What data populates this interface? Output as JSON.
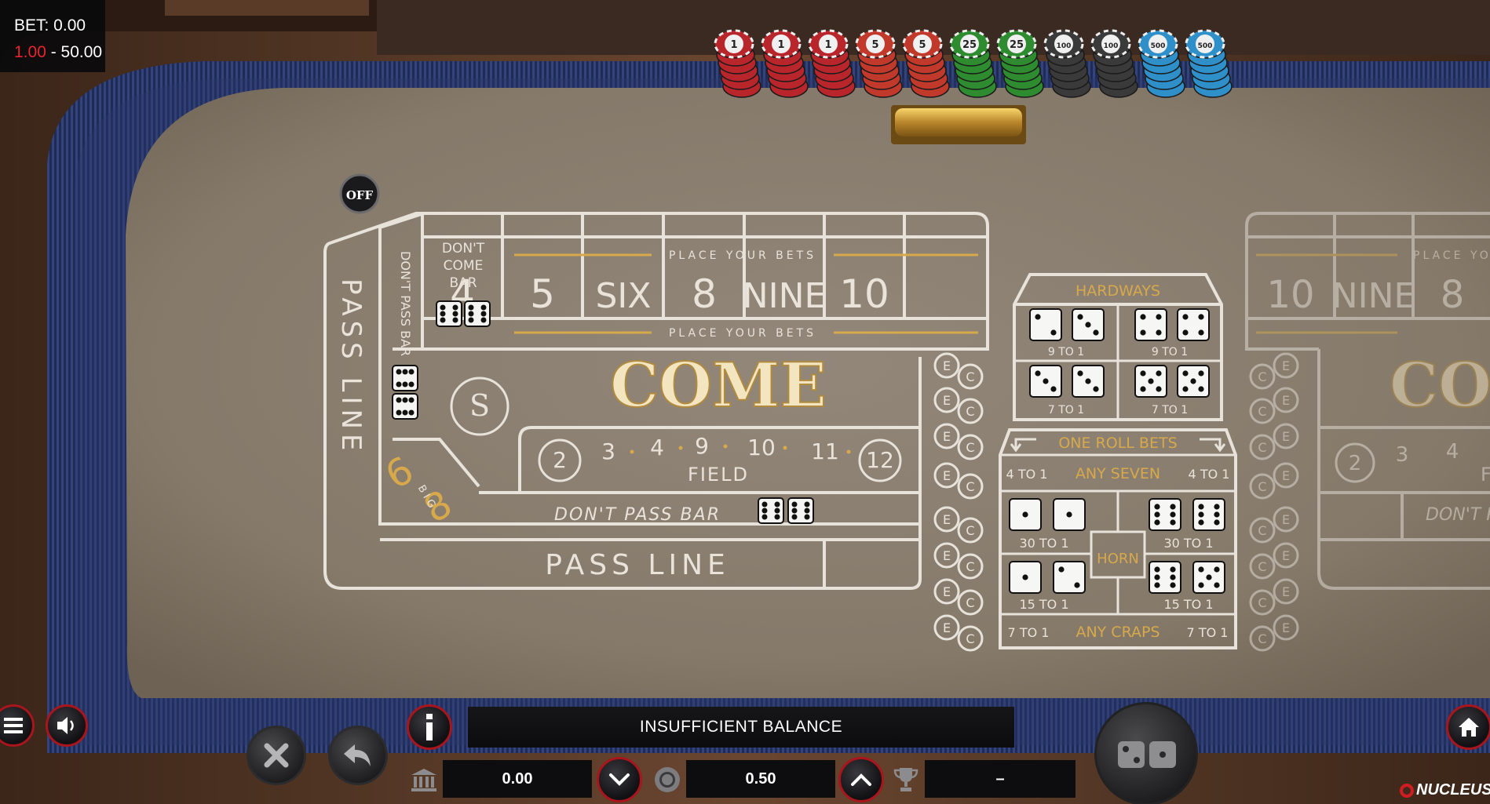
{
  "bet_panel": {
    "bet_label": "BET: 0.00",
    "limit_min": "1.00",
    "limit_separator": " - ",
    "limit_max": "50.00"
  },
  "puck": {
    "label": "OFF"
  },
  "chip_rack": {
    "chips": [
      {
        "label": "1",
        "color": "#b8262b"
      },
      {
        "label": "1",
        "color": "#b8262b"
      },
      {
        "label": "1",
        "color": "#b8262b"
      },
      {
        "label": "5",
        "color": "#c0392b"
      },
      {
        "label": "5",
        "color": "#c0392b"
      },
      {
        "label": "25",
        "color": "#2e8b2f"
      },
      {
        "label": "25",
        "color": "#2e8b2f"
      },
      {
        "label": "100",
        "color": "#3a3a3a"
      },
      {
        "label": "100",
        "color": "#3a3a3a"
      },
      {
        "label": "500",
        "color": "#2f8fc9"
      },
      {
        "label": "500",
        "color": "#2f8fc9"
      }
    ]
  },
  "layout": {
    "dont_come_bar": [
      "DON'T",
      "COME",
      "BAR"
    ],
    "dont_pass_bar_vertical": "DON'T PASS BAR",
    "pass_line_vertical": "PASS LINE",
    "place_your_bets": "PLACE YOUR BETS",
    "place_numbers": [
      "4",
      "5",
      "SIX",
      "8",
      "NINE",
      "10"
    ],
    "come": "COME",
    "field_numbers": [
      "2",
      "3",
      "4",
      "9",
      "10",
      "11",
      "12"
    ],
    "field_label": "FIELD",
    "dont_pass_bar": "DON'T PASS BAR",
    "pass_line": "PASS LINE",
    "big_6": "6",
    "big_8": "8",
    "big_text": "B I G",
    "e_label": "E",
    "c_label": "C"
  },
  "hardways": {
    "title": "HARDWAYS",
    "odds": [
      "9 TO 1",
      "9 TO 1",
      "7 TO 1",
      "7 TO 1"
    ]
  },
  "one_roll": {
    "title": "ONE ROLL BETS",
    "any_seven": "ANY SEVEN",
    "any_seven_odds_left": "4 TO 1",
    "any_seven_odds_right": "4 TO 1",
    "horn": "HORN",
    "odds_30_left": "30 TO 1",
    "odds_30_right": "30 TO 1",
    "odds_15_left": "15 TO 1",
    "odds_15_right": "15 TO 1",
    "any_craps": "ANY CRAPS",
    "any_craps_odds_left": "7 TO 1",
    "any_craps_odds_right": "7 TO 1"
  },
  "mirror_layout": {
    "place_numbers": [
      "10",
      "NINE",
      "8"
    ],
    "place_your_bets": "PLACE YO",
    "come": "CO",
    "field_numbers": [
      "2",
      "3",
      "4"
    ],
    "field_label": "F",
    "dont_pass": "DON'T P"
  },
  "controls": {
    "message": "INSUFFICIENT BALANCE",
    "balance_value": "0.00",
    "chip_value": "0.50",
    "win_value": "–",
    "brand": "NUCLEUS"
  },
  "colors": {
    "felt": "#8a7d6c",
    "rail_blue": "#2b3a6e",
    "wood": "#5b3a24",
    "accent_red": "#a9151c",
    "gold": "#d7a94b"
  }
}
